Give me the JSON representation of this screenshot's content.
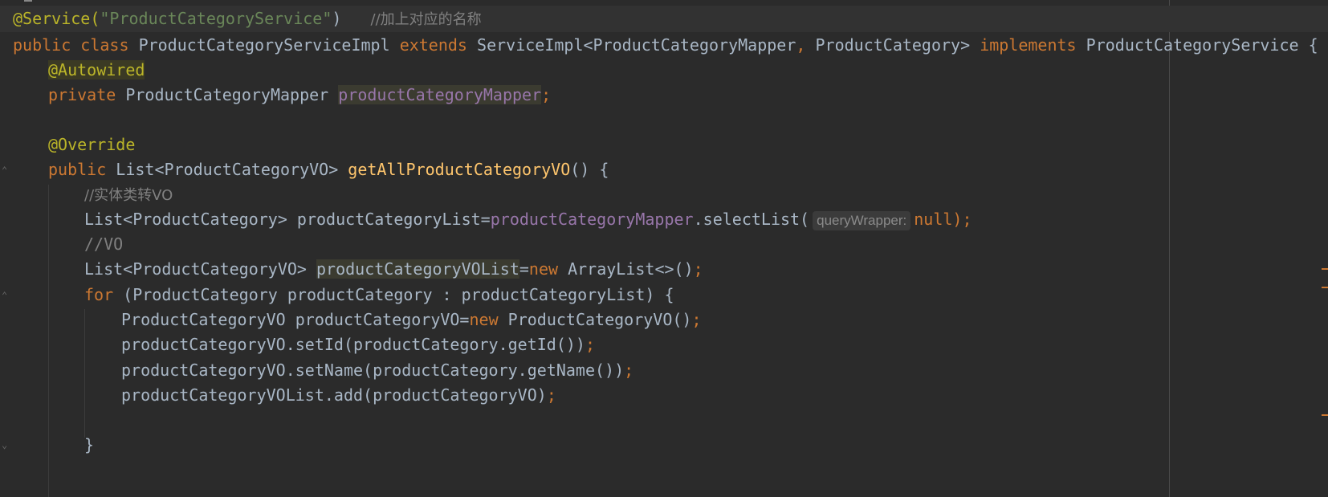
{
  "editor": {
    "lines": {
      "l1_ann": "@Service(",
      "l1_str": "\"ProductCategoryService\"",
      "l1_close": ")",
      "l1_comment": "//加上对应的名称",
      "l2_public": "public",
      "l2_class": "class",
      "l2_name": "ProductCategoryServiceImpl",
      "l2_extends": "extends",
      "l2_type1": "ServiceImpl<ProductCategoryMapper",
      "l2_comma": ",",
      "l2_type2": "ProductCategory>",
      "l2_implements": "implements",
      "l2_iface": "ProductCategoryService {",
      "l3_ann": "@Autowired",
      "l4_private": "private",
      "l4_type": "ProductCategoryMapper",
      "l4_field": "productCategoryMapper",
      "l4_semi": ";",
      "l6_ann": "@Override",
      "l7_public": "public",
      "l7_type": "List<ProductCategoryVO>",
      "l7_method": "getAllProductCategoryVO",
      "l7_rest": "() {",
      "l8_comment": "//实体类转VO",
      "l9_type": "List<ProductCategory> productCategoryList=",
      "l9_field": "productCategoryMapper",
      "l9_call": ".selectList(",
      "l9_hint": "queryWrapper:",
      "l9_null": "null",
      "l9_end": ");",
      "l10_comment": "//VO",
      "l11_type": "List<ProductCategoryVO>",
      "l11_var": "productCategoryVOList",
      "l11_eq": "=",
      "l11_new": "new",
      "l11_rest": "ArrayList<>()",
      "l11_semi": ";",
      "l12_for": "for",
      "l12_rest": "(ProductCategory productCategory : productCategoryList) {",
      "l13_start": "ProductCategoryVO productCategoryVO=",
      "l13_new": "new",
      "l13_rest": "ProductCategoryVO()",
      "l13_semi": ";",
      "l14_code": "productCategoryVO.setId(productCategory.getId())",
      "l14_semi": ";",
      "l15_code": "productCategoryVO.setName(productCategory.getName())",
      "l15_semi": ";",
      "l16_code": "productCategoryVOList.add(productCategoryVO)",
      "l16_semi": ";",
      "l18_brace": "}"
    }
  },
  "colors": {
    "background": "#2b2b2b",
    "keyword": "#cc7832",
    "annotation": "#bbb529",
    "string": "#6a8759",
    "comment": "#808080",
    "method": "#ffc66d",
    "field": "#9876aa",
    "text": "#a9b7c6"
  }
}
